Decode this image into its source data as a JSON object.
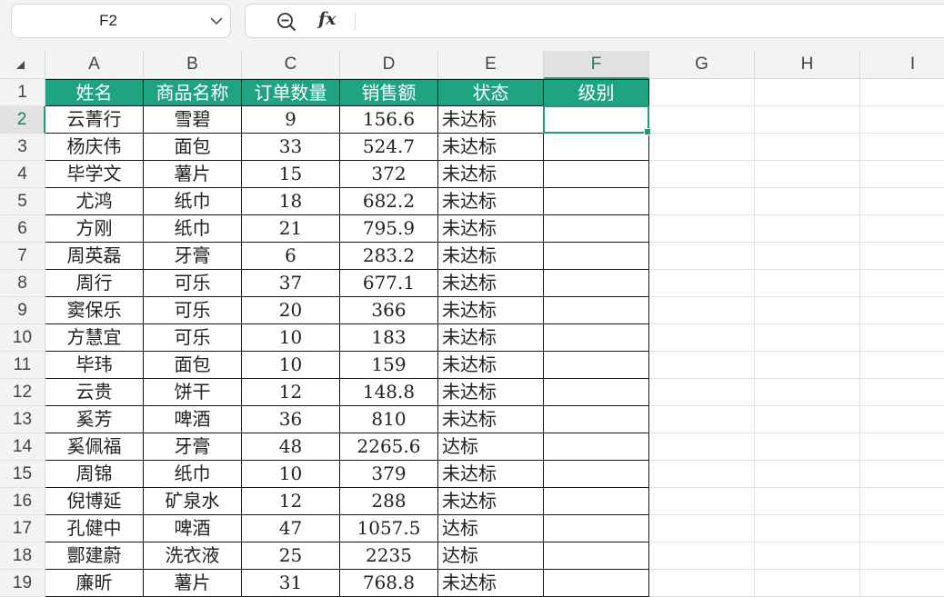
{
  "name_box": {
    "value": "F2"
  },
  "formula_bar": {
    "fx_label": "fx",
    "content": ""
  },
  "columns": [
    "A",
    "B",
    "C",
    "D",
    "E",
    "F",
    "G",
    "H",
    "I"
  ],
  "selected": {
    "column": "F",
    "row": 2
  },
  "table": {
    "headers": [
      "姓名",
      "商品名称",
      "订单数量",
      "销售额",
      "状态",
      "级别"
    ],
    "rows": [
      [
        "云菁行",
        "雪碧",
        "9",
        "156.6",
        "未达标",
        ""
      ],
      [
        "杨庆伟",
        "面包",
        "33",
        "524.7",
        "未达标",
        ""
      ],
      [
        "毕学文",
        "薯片",
        "15",
        "372",
        "未达标",
        ""
      ],
      [
        "尤鸿",
        "纸巾",
        "18",
        "682.2",
        "未达标",
        ""
      ],
      [
        "方刚",
        "纸巾",
        "21",
        "795.9",
        "未达标",
        ""
      ],
      [
        "周英磊",
        "牙膏",
        "6",
        "283.2",
        "未达标",
        ""
      ],
      [
        "周行",
        "可乐",
        "37",
        "677.1",
        "未达标",
        ""
      ],
      [
        "窦保乐",
        "可乐",
        "20",
        "366",
        "未达标",
        ""
      ],
      [
        "方慧宜",
        "可乐",
        "10",
        "183",
        "未达标",
        ""
      ],
      [
        "毕玮",
        "面包",
        "10",
        "159",
        "未达标",
        ""
      ],
      [
        "云贵",
        "饼干",
        "12",
        "148.8",
        "未达标",
        ""
      ],
      [
        "奚芳",
        "啤酒",
        "36",
        "810",
        "未达标",
        ""
      ],
      [
        "奚佩福",
        "牙膏",
        "48",
        "2265.6",
        "达标",
        ""
      ],
      [
        "周锦",
        "纸巾",
        "10",
        "379",
        "未达标",
        ""
      ],
      [
        "倪博延",
        "矿泉水",
        "12",
        "288",
        "未达标",
        ""
      ],
      [
        "孔健中",
        "啤酒",
        "47",
        "1057.5",
        "达标",
        ""
      ],
      [
        "酆建蔚",
        "洗衣液",
        "25",
        "2235",
        "达标",
        ""
      ],
      [
        "廉昕",
        "薯片",
        "31",
        "768.8",
        "未达标",
        ""
      ]
    ]
  },
  "colors": {
    "header_fill": "#20a383",
    "selection": "#1f9b77"
  }
}
